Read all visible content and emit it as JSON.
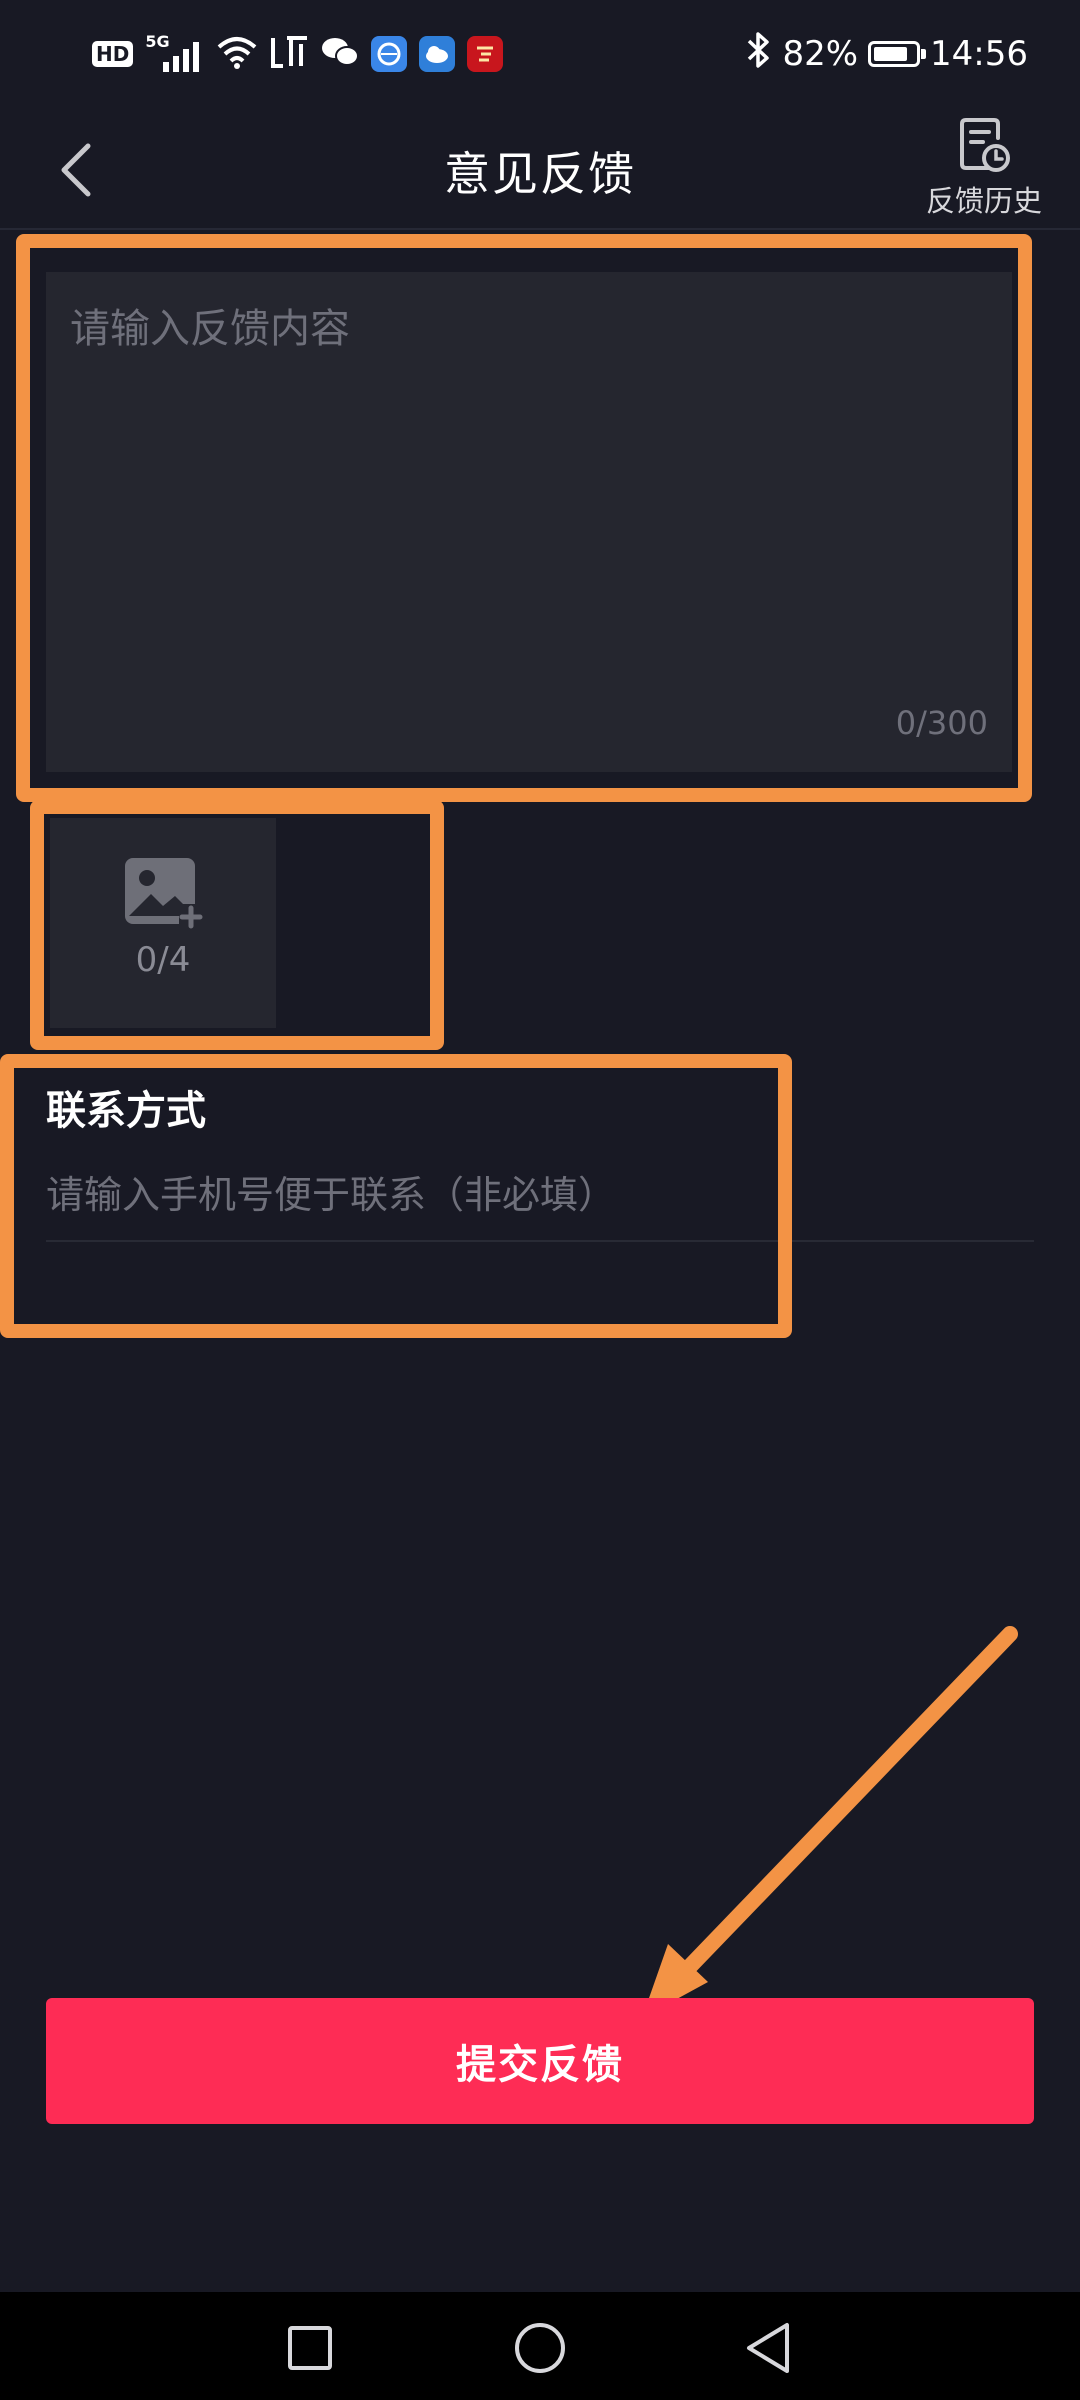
{
  "status_bar": {
    "network_badge": "HD",
    "network_type": "5G",
    "battery_percent": "82%",
    "battery_level": 0.82,
    "time": "14:56",
    "icons": [
      "hd-icon",
      "signal-5g-icon",
      "wifi-icon",
      "listen-app-icon",
      "wechat-icon",
      "browser-icon",
      "weather-icon",
      "study-app-icon",
      "bluetooth-icon",
      "battery-icon"
    ]
  },
  "header": {
    "title": "意见反馈",
    "history_label": "反馈历史"
  },
  "feedback": {
    "placeholder": "请输入反馈内容",
    "value": "",
    "char_count": "0/300"
  },
  "image_upload": {
    "count": "0/4"
  },
  "contact": {
    "title": "联系方式",
    "placeholder": "请输入手机号便于联系（非必填）",
    "value": ""
  },
  "submit": {
    "label": "提交反馈"
  },
  "colors": {
    "background": "#181924",
    "input_background": "#25262f",
    "accent": "#fe2c55",
    "annotation": "#f39345",
    "placeholder": "#6f707b"
  }
}
